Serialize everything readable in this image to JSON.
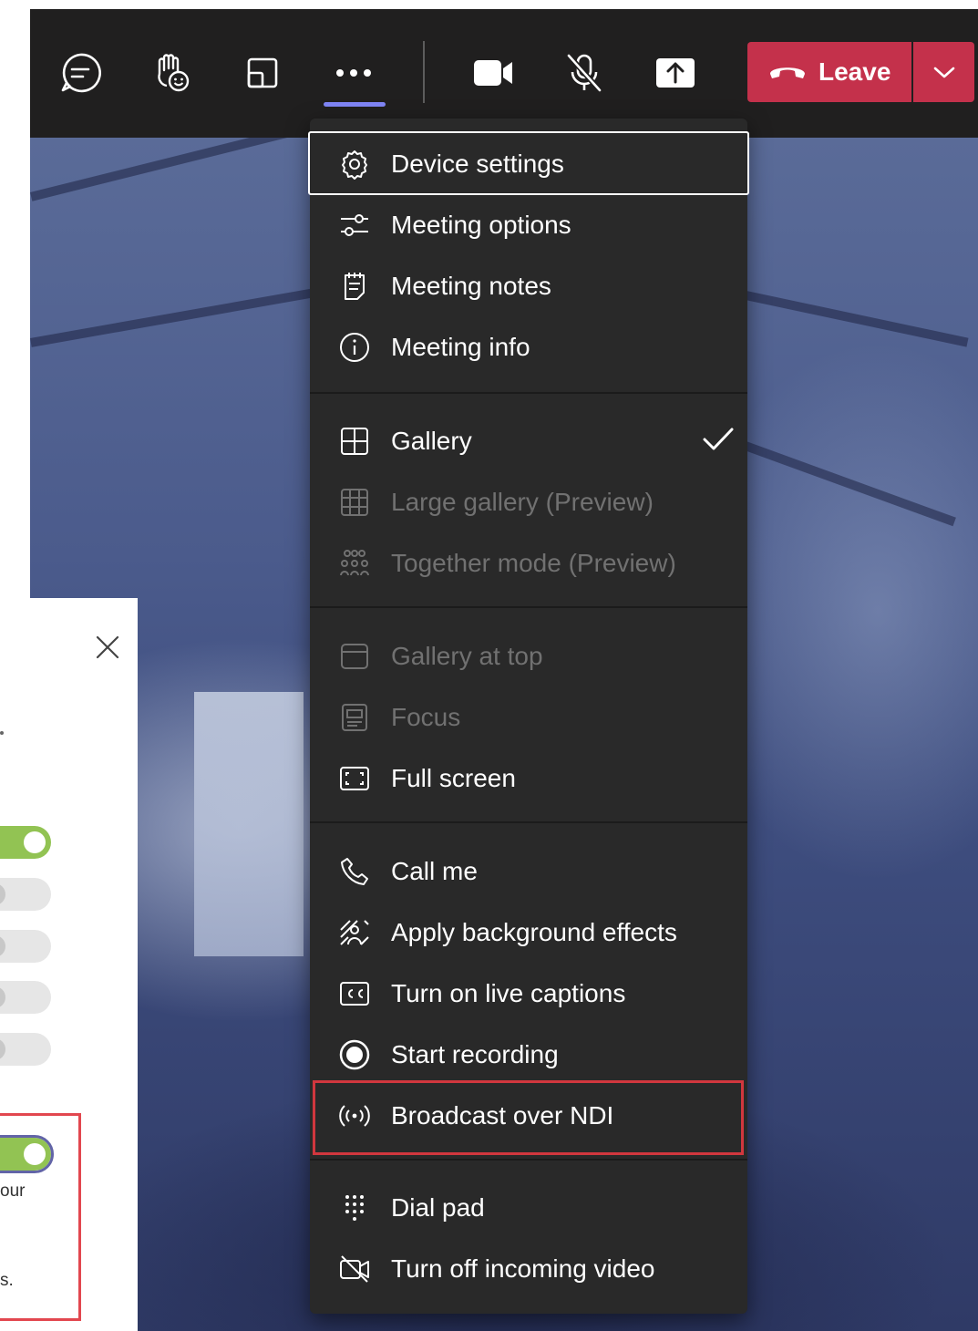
{
  "toolbar": {
    "buttons": [
      {
        "name": "chat-icon"
      },
      {
        "name": "raise-hand-icon"
      },
      {
        "name": "breakout-rooms-icon"
      },
      {
        "name": "more-actions-icon"
      },
      {
        "name": "camera-icon"
      },
      {
        "name": "mic-off-icon"
      },
      {
        "name": "share-tray-icon"
      }
    ],
    "leave_label": "Leave",
    "leave_color": "#c4314b",
    "active_underline_color": "#7f85f5"
  },
  "menu": {
    "sections": [
      {
        "items": [
          {
            "label": "Device settings",
            "icon": "gear-icon",
            "disabled": false,
            "focused": true
          },
          {
            "label": "Meeting options",
            "icon": "sliders-icon",
            "disabled": false
          },
          {
            "label": "Meeting notes",
            "icon": "notes-icon",
            "disabled": false
          },
          {
            "label": "Meeting info",
            "icon": "info-icon",
            "disabled": false
          }
        ]
      },
      {
        "items": [
          {
            "label": "Gallery",
            "icon": "gallery-icon",
            "disabled": false,
            "checked": true
          },
          {
            "label": "Large gallery (Preview)",
            "icon": "large-gallery-icon",
            "disabled": true
          },
          {
            "label": "Together mode (Preview)",
            "icon": "together-mode-icon",
            "disabled": true
          }
        ]
      },
      {
        "items": [
          {
            "label": "Gallery at top",
            "icon": "gallery-top-icon",
            "disabled": true
          },
          {
            "label": "Focus",
            "icon": "focus-icon",
            "disabled": true
          },
          {
            "label": "Full screen",
            "icon": "fullscreen-icon",
            "disabled": false
          }
        ]
      },
      {
        "items": [
          {
            "label": "Call me",
            "icon": "phone-icon",
            "disabled": false
          },
          {
            "label": "Apply background effects",
            "icon": "background-effects-icon",
            "disabled": false
          },
          {
            "label": "Turn on live captions",
            "icon": "captions-icon",
            "disabled": false
          },
          {
            "label": "Start recording",
            "icon": "record-icon",
            "disabled": false
          },
          {
            "label": "Broadcast over NDI",
            "icon": "broadcast-icon",
            "disabled": false,
            "highlighted": true
          }
        ]
      },
      {
        "items": [
          {
            "label": "Dial pad",
            "icon": "dialpad-icon",
            "disabled": false
          },
          {
            "label": "Turn off incoming video",
            "icon": "video-off-icon",
            "disabled": false
          }
        ]
      }
    ],
    "highlight_color": "#d1373e"
  },
  "side_panel": {
    "toggles": [
      {
        "state": "on"
      },
      {
        "state": "off"
      },
      {
        "state": "off"
      },
      {
        "state": "off"
      },
      {
        "state": "off"
      },
      {
        "state": "on",
        "focused": true
      }
    ],
    "fragments": [
      "our",
      "s."
    ],
    "toggle_on_color": "#92c353"
  }
}
